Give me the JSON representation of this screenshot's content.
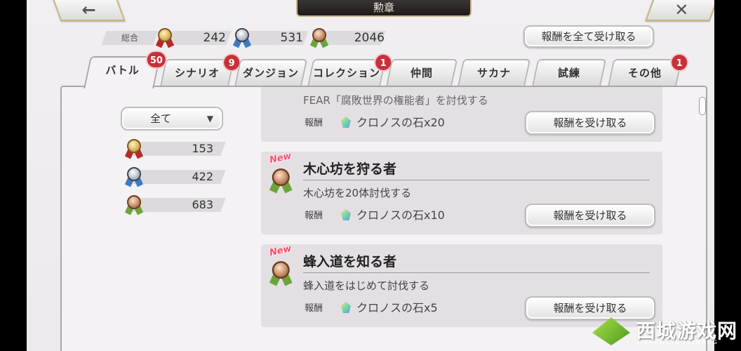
{
  "header": {
    "title": "勲章",
    "back_icon": "←",
    "close_icon": "✕"
  },
  "totals": {
    "label": "総合",
    "gold": "242",
    "silver": "531",
    "bronze": "2046",
    "collect_all_label": "報酬を全て受け取る"
  },
  "tabs": [
    {
      "label": "バトル",
      "badge": "50"
    },
    {
      "label": "シナリオ",
      "badge": "9"
    },
    {
      "label": "ダンジョン",
      "badge": ""
    },
    {
      "label": "コレクション",
      "badge": "1"
    },
    {
      "label": "仲間",
      "badge": ""
    },
    {
      "label": "サカナ",
      "badge": ""
    },
    {
      "label": "試練",
      "badge": ""
    },
    {
      "label": "その他",
      "badge": "1"
    }
  ],
  "filter": {
    "selected": "全て",
    "chevron": "▼"
  },
  "counts": {
    "gold": "153",
    "silver": "422",
    "bronze": "683"
  },
  "missions": [
    {
      "title": "",
      "desc": "FEAR「腐敗世界の権能者」を討伐する",
      "reward_label": "報酬",
      "reward": "クロノスの石x20",
      "claim_label": "報酬を受け取る",
      "new": ""
    },
    {
      "title": "木心坊を狩る者",
      "desc": "木心坊を20体討伐する",
      "reward_label": "報酬",
      "reward": "クロノスの石x10",
      "claim_label": "報酬を受け取る",
      "new": "New"
    },
    {
      "title": "蜂入道を知る者",
      "desc": "蜂入道をはじめて討伐する",
      "reward_label": "報酬",
      "reward": "クロノスの石x5",
      "claim_label": "報酬を受け取る",
      "new": "New"
    }
  ],
  "watermark": {
    "title": "西城游戏网",
    "sub": "XICHENGYOUXIWANG"
  }
}
